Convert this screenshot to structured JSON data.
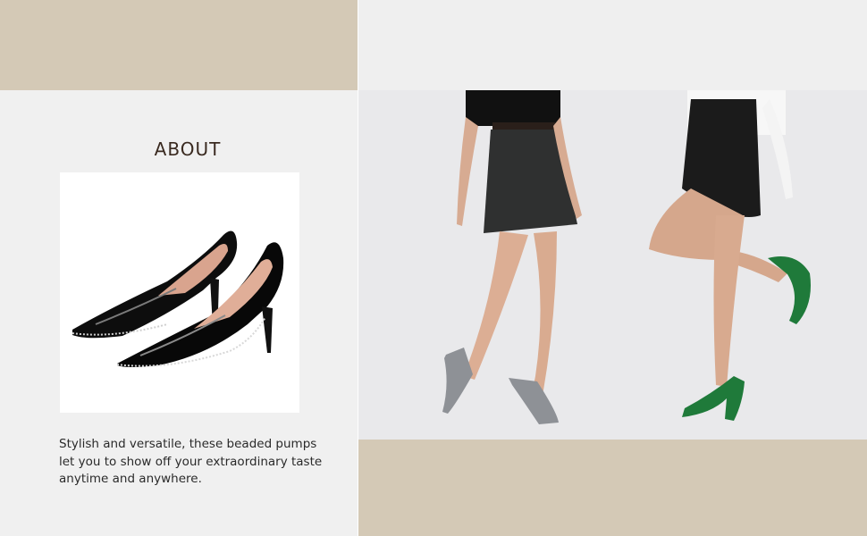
{
  "colors": {
    "tan": "#d4c9b6",
    "panel_gray": "#f0f0f0",
    "heading": "#3a2a20"
  },
  "heading": "ABOUT",
  "description": "  Stylish and versatile, these beaded pumps\nlet you to show off your extraordinary taste\nanytime and anywhere.",
  "images": {
    "product": "black-patent-beaded-pumps-photo",
    "lifestyle": "models-wearing-gray-and-green-pumps-photo"
  }
}
